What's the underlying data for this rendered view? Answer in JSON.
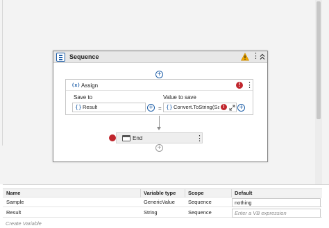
{
  "sequence": {
    "title": "Sequence"
  },
  "assign": {
    "title": "Assign",
    "icon_text": "(x)",
    "save_to_label": "Save to",
    "value_to_save_label": "Value to save",
    "save_to_value": "Result",
    "value_to_save_value": "Convert.ToString(Sa",
    "equals": "="
  },
  "end": {
    "title": "End"
  },
  "variables": {
    "columns": [
      "Name",
      "Variable type",
      "Scope",
      "Default"
    ],
    "rows": [
      {
        "name": "Sample",
        "type": "GenericValue",
        "scope": "Sequence",
        "default": "nothing",
        "default_is_placeholder": false
      },
      {
        "name": "Result",
        "type": "String",
        "scope": "Sequence",
        "default": "Enter a VB expression",
        "default_is_placeholder": true
      }
    ],
    "create_variable": "Create Variable"
  },
  "icons": {
    "sequence": "sequence-icon",
    "warning": "warning-icon",
    "error": "error-icon",
    "more": "more-vertical-icon",
    "collapse": "collapse-icon",
    "add": "add-activity-icon",
    "expand": "expand-icon",
    "breakpoint": "breakpoint-icon",
    "end": "end-activity-icon"
  },
  "colors": {
    "accent": "#1f5fa8",
    "error": "#c0262d",
    "warning": "#f2a900"
  }
}
